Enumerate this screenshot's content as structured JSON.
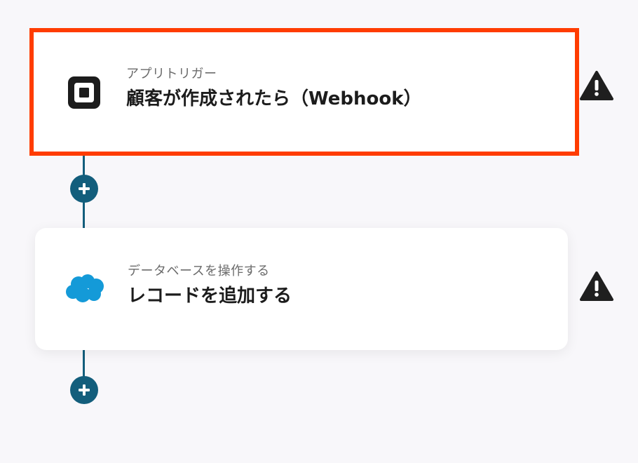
{
  "colors": {
    "accent": "#135e7c",
    "selected_border": "#ff3c00",
    "warning": "#1f1f1f",
    "salesforce": "#149ad8"
  },
  "steps": [
    {
      "kind": "trigger",
      "subtitle": "アプリトリガー",
      "title": "顧客が作成されたら（Webhook）",
      "icon": "square-logo-icon",
      "selected": true,
      "warning": true
    },
    {
      "kind": "action",
      "subtitle": "データベースを操作する",
      "title": "レコードを追加する",
      "icon": "salesforce-cloud-icon",
      "selected": false,
      "warning": true
    }
  ]
}
